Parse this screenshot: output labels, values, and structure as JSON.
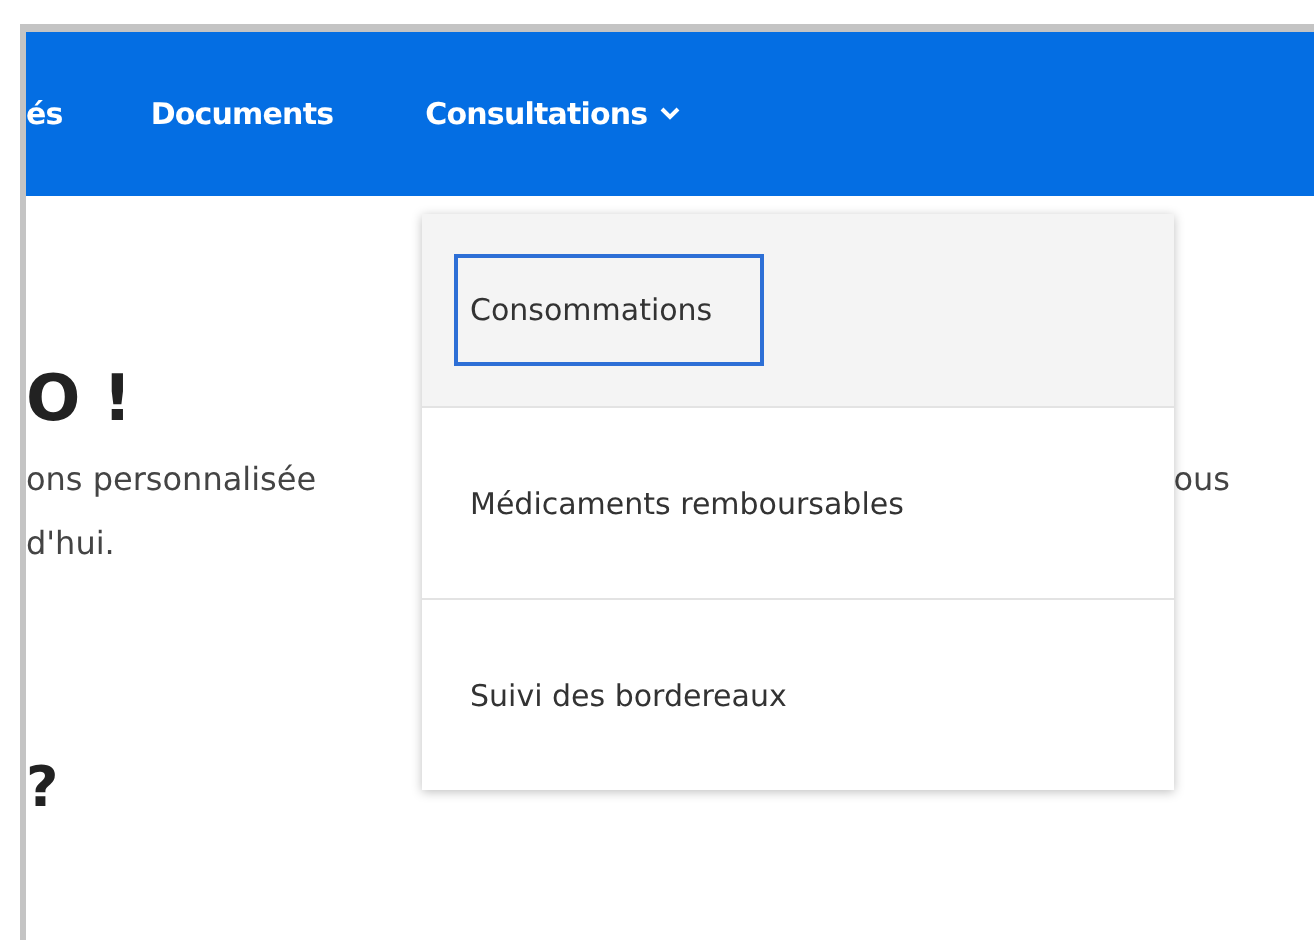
{
  "nav": {
    "items": [
      {
        "label": "és",
        "kind": "link"
      },
      {
        "label": "Documents",
        "kind": "link"
      },
      {
        "label": "Consultations",
        "kind": "dropdown",
        "expanded": true
      }
    ]
  },
  "dropdown": {
    "items": [
      {
        "label": "Consommations",
        "selected": true
      },
      {
        "label": "Médicaments remboursables",
        "selected": false
      },
      {
        "label": "Suivi des bordereaux",
        "selected": false
      }
    ]
  },
  "content": {
    "heading": "O !",
    "line_1_left": "ons personnalisée",
    "line_1_right": "ous",
    "line_2": "d'hui.",
    "subheading": "?"
  }
}
